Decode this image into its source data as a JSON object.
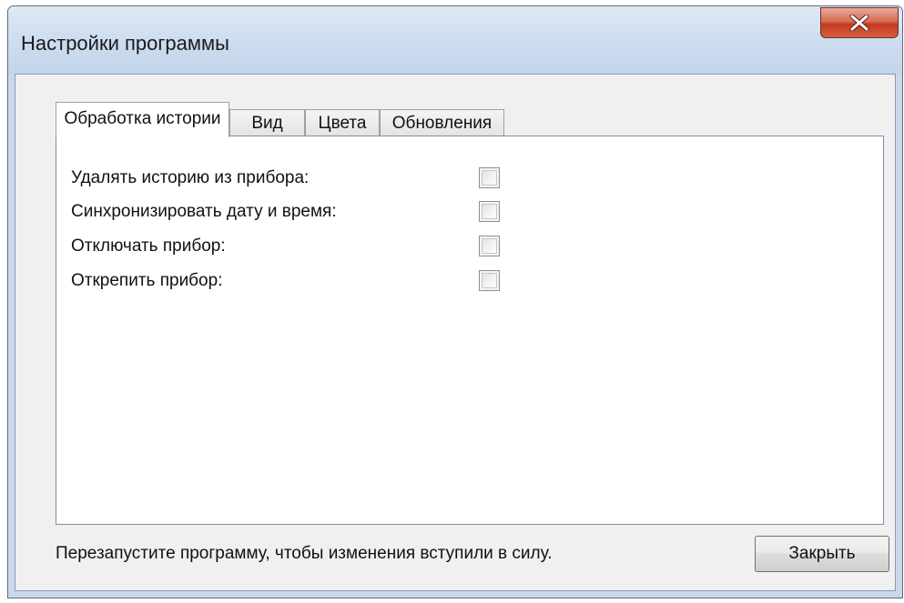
{
  "window": {
    "title": "Настройки программы"
  },
  "tabs": [
    {
      "label": "Обработка истории",
      "active": true
    },
    {
      "label": "Вид",
      "active": false
    },
    {
      "label": "Цвета",
      "active": false
    },
    {
      "label": "Обновления",
      "active": false
    }
  ],
  "options": [
    {
      "label": "Удалять историю из прибора:",
      "checked": false
    },
    {
      "label": "Синхронизировать дату и время:",
      "checked": false
    },
    {
      "label": "Отключать прибор:",
      "checked": false
    },
    {
      "label": "Открепить прибор:",
      "checked": false
    }
  ],
  "footer": {
    "status": "Перезапустите программу, чтобы изменения вступили в силу.",
    "close_label": "Закрыть"
  },
  "icons": {
    "close": "close-icon"
  },
  "colors": {
    "titlebar": "#cfdef0",
    "close_button": "#c33a20",
    "client_bg": "#f0f0f0"
  }
}
